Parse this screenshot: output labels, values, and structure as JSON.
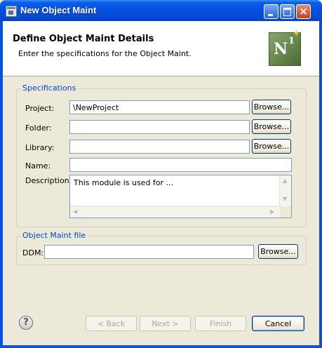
{
  "window": {
    "title": "New Object Maint"
  },
  "header": {
    "title": "Define Object Maint Details",
    "description": "Enter the specifications for the Object Maint.",
    "logo_text": "N",
    "logo_superscript": "1"
  },
  "specifications": {
    "legend": "Specifications",
    "project_label": "Project:",
    "project_value": "\\NewProject",
    "folder_label": "Folder:",
    "folder_value": "",
    "library_label": "Library:",
    "library_value": "",
    "name_label": "Name:",
    "name_value": "",
    "description_label": "Description:",
    "description_value": "This module is used for ...",
    "browse_label": "Browse..."
  },
  "object_file": {
    "legend": "Object Maint file",
    "ddm_label": "DDM:",
    "ddm_value": "",
    "browse_label": "Browse..."
  },
  "footer": {
    "help_label": "?",
    "back_label": "< Back",
    "next_label": "Next >",
    "finish_label": "Finish",
    "cancel_label": "Cancel"
  },
  "icons": {
    "app": "window-app-icon",
    "logo": "natural-n1-logo-icon",
    "help": "help-icon",
    "scroll_up": "scroll-up-arrow-icon",
    "scroll_down": "scroll-down-arrow-icon",
    "scroll_left": "scroll-left-arrow-icon",
    "scroll_right": "scroll-right-arrow-icon"
  },
  "colors": {
    "titlebar": "#0451dd",
    "dialog_bg": "#ece9d8",
    "legend_text": "#0046d5",
    "field_border": "#7f9db9",
    "logo_bg": "#6b8a4e",
    "logo_star": "#f3c221"
  }
}
